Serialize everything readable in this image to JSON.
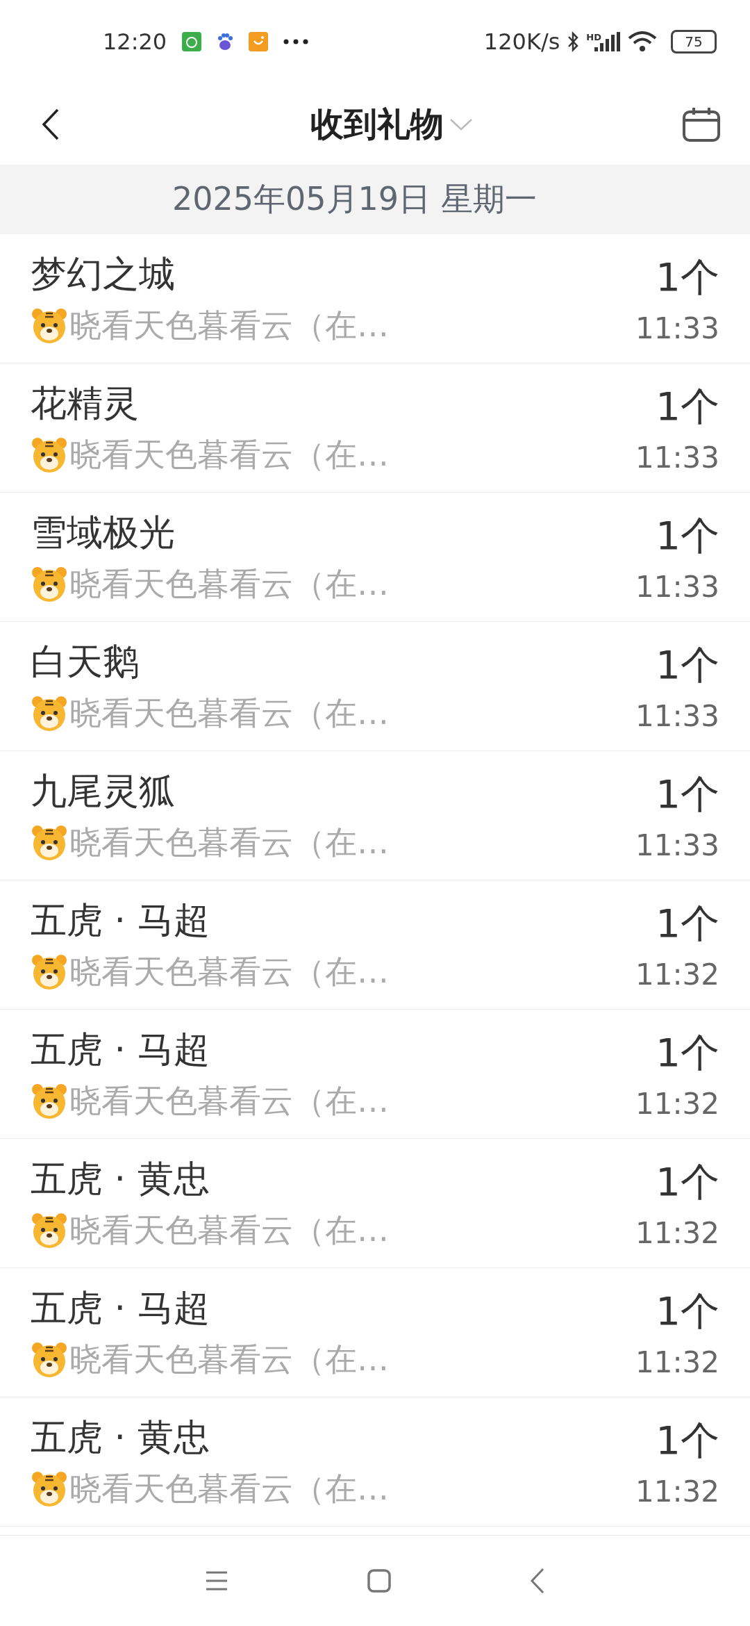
{
  "status_bar": {
    "time": "12:20",
    "network_speed": "120K/s",
    "signal_label": "HD",
    "battery": "75"
  },
  "header": {
    "title": "收到礼物"
  },
  "date_header": "2025年05月19日 星期一",
  "gifts": [
    {
      "name": "梦幻之城",
      "count": "1个",
      "sender": "晓看天色暮看云（在…",
      "time": "11:33"
    },
    {
      "name": "花精灵",
      "count": "1个",
      "sender": "晓看天色暮看云（在…",
      "time": "11:33"
    },
    {
      "name": "雪域极光",
      "count": "1个",
      "sender": "晓看天色暮看云（在…",
      "time": "11:33"
    },
    {
      "name": "白天鹅",
      "count": "1个",
      "sender": "晓看天色暮看云（在…",
      "time": "11:33"
    },
    {
      "name": "九尾灵狐",
      "count": "1个",
      "sender": "晓看天色暮看云（在…",
      "time": "11:33"
    },
    {
      "name": "五虎 · 马超",
      "count": "1个",
      "sender": "晓看天色暮看云（在…",
      "time": "11:32"
    },
    {
      "name": "五虎 · 马超",
      "count": "1个",
      "sender": "晓看天色暮看云（在…",
      "time": "11:32"
    },
    {
      "name": "五虎 · 黄忠",
      "count": "1个",
      "sender": "晓看天色暮看云（在…",
      "time": "11:32"
    },
    {
      "name": "五虎 · 马超",
      "count": "1个",
      "sender": "晓看天色暮看云（在…",
      "time": "11:32"
    },
    {
      "name": "五虎 · 黄忠",
      "count": "1个",
      "sender": "晓看天色暮看云（在…",
      "time": "11:32"
    }
  ]
}
